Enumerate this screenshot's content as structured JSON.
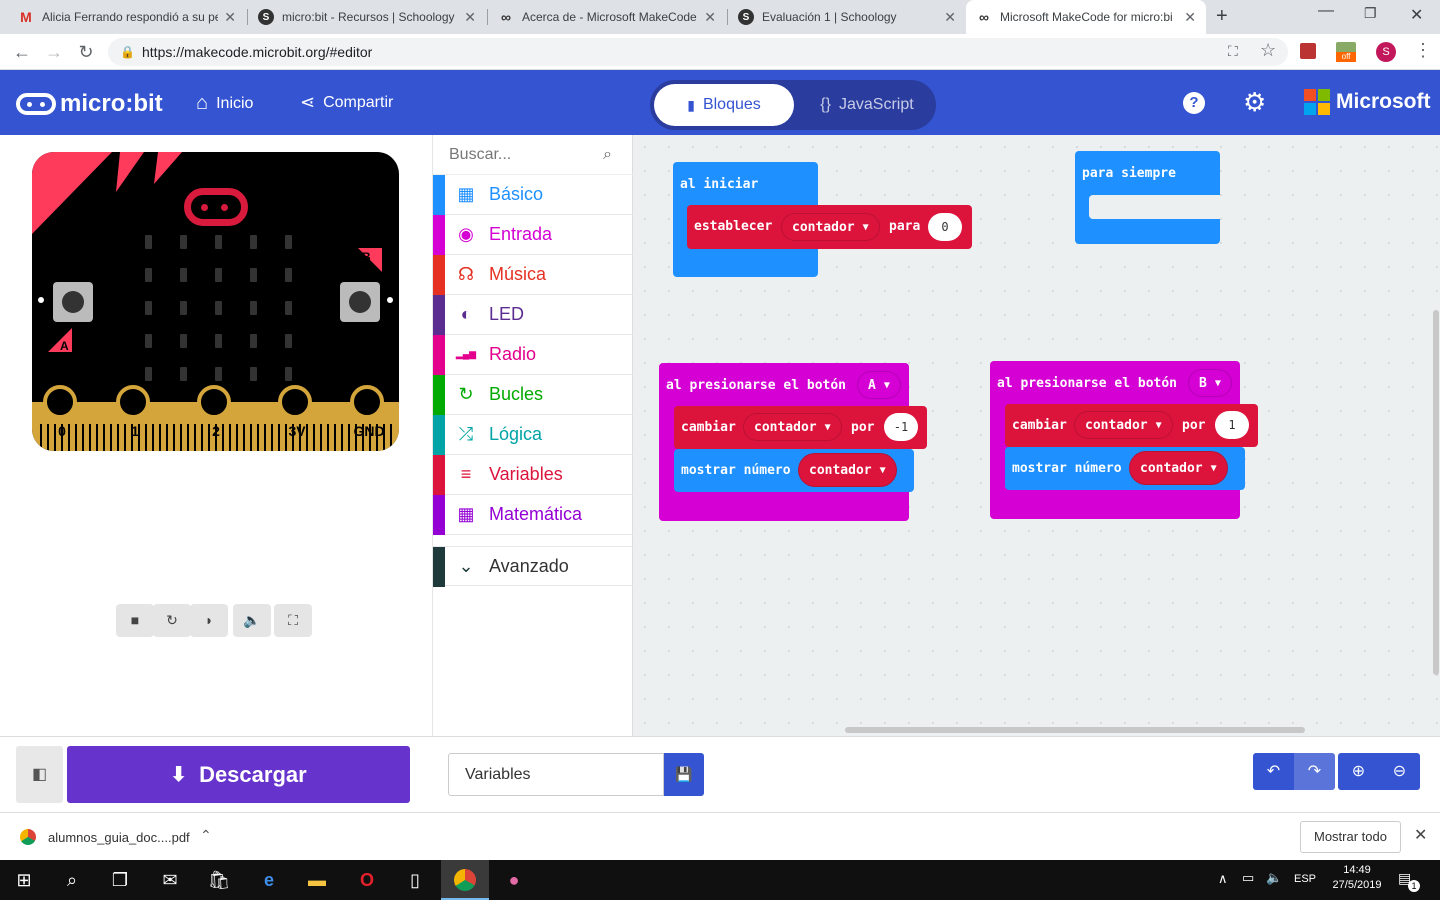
{
  "browser": {
    "tabs": [
      {
        "favicon": "gmail-icon",
        "fav_text": "M",
        "title": "Alicia Ferrando respondió a su pe"
      },
      {
        "favicon": "schoology-icon",
        "fav_text": "S",
        "title": "micro:bit - Recursos | Schoology"
      },
      {
        "favicon": "makecode-icon",
        "fav_text": "∞",
        "title": "Acerca de - Microsoft MakeCode"
      },
      {
        "favicon": "schoology-icon",
        "fav_text": "S",
        "title": "Evaluación 1 | Schoology"
      },
      {
        "favicon": "makecode-icon",
        "fav_text": "∞",
        "title": "Microsoft MakeCode for micro:bi"
      }
    ],
    "url": "https://makecode.microbit.org/#editor",
    "profile_initial": "S",
    "ext_badge": "off"
  },
  "header": {
    "logo": "micro:bit",
    "home": "Inicio",
    "share": "Compartir",
    "mode_blocks": "Bloques",
    "mode_js": "JavaScript",
    "brand": "Microsoft"
  },
  "simulator": {
    "pins": [
      "0",
      "1",
      "2",
      "3V",
      "GND"
    ],
    "button_a": "A",
    "button_b": "B"
  },
  "toolbox": {
    "search_placeholder": "Buscar...",
    "categories": [
      {
        "label": "Básico",
        "color": "#1e90ff",
        "icon": "grid-icon"
      },
      {
        "label": "Entrada",
        "color": "#d400d4",
        "icon": "target-icon"
      },
      {
        "label": "Música",
        "color": "#e63022",
        "icon": "headphones-icon"
      },
      {
        "label": "LED",
        "color": "#5c2d91",
        "icon": "toggle-icon"
      },
      {
        "label": "Radio",
        "color": "#e3008c",
        "icon": "signal-icon"
      },
      {
        "label": "Bucles",
        "color": "#00aa00",
        "icon": "refresh-icon"
      },
      {
        "label": "Lógica",
        "color": "#00a4a6",
        "icon": "shuffle-icon"
      },
      {
        "label": "Variables",
        "color": "#dc143c",
        "icon": "list-icon"
      },
      {
        "label": "Matemática",
        "color": "#9400d3",
        "icon": "calculator-icon"
      },
      {
        "label": "Avanzado",
        "color": "#1e3a3a",
        "icon": "chevron-down-icon"
      }
    ]
  },
  "blocks": {
    "on_start": "al iniciar",
    "set_var": "establecer",
    "var_name": "contador",
    "to": "para",
    "init_value": "0",
    "forever": "para siempre",
    "on_button": "al presionarse el botón",
    "button_a": "A",
    "button_b": "B",
    "change": "cambiar",
    "by": "por",
    "change_a": "-1",
    "change_b": "1",
    "show_number": "mostrar número"
  },
  "editorbar": {
    "download": "Descargar",
    "project_name": "Variables"
  },
  "shelf": {
    "file": "alumnos_guia_doc....pdf",
    "show_all": "Mostrar todo"
  },
  "taskbar": {
    "lang": "ESP",
    "time": "14:49",
    "date": "27/5/2019",
    "notif_count": "1"
  }
}
